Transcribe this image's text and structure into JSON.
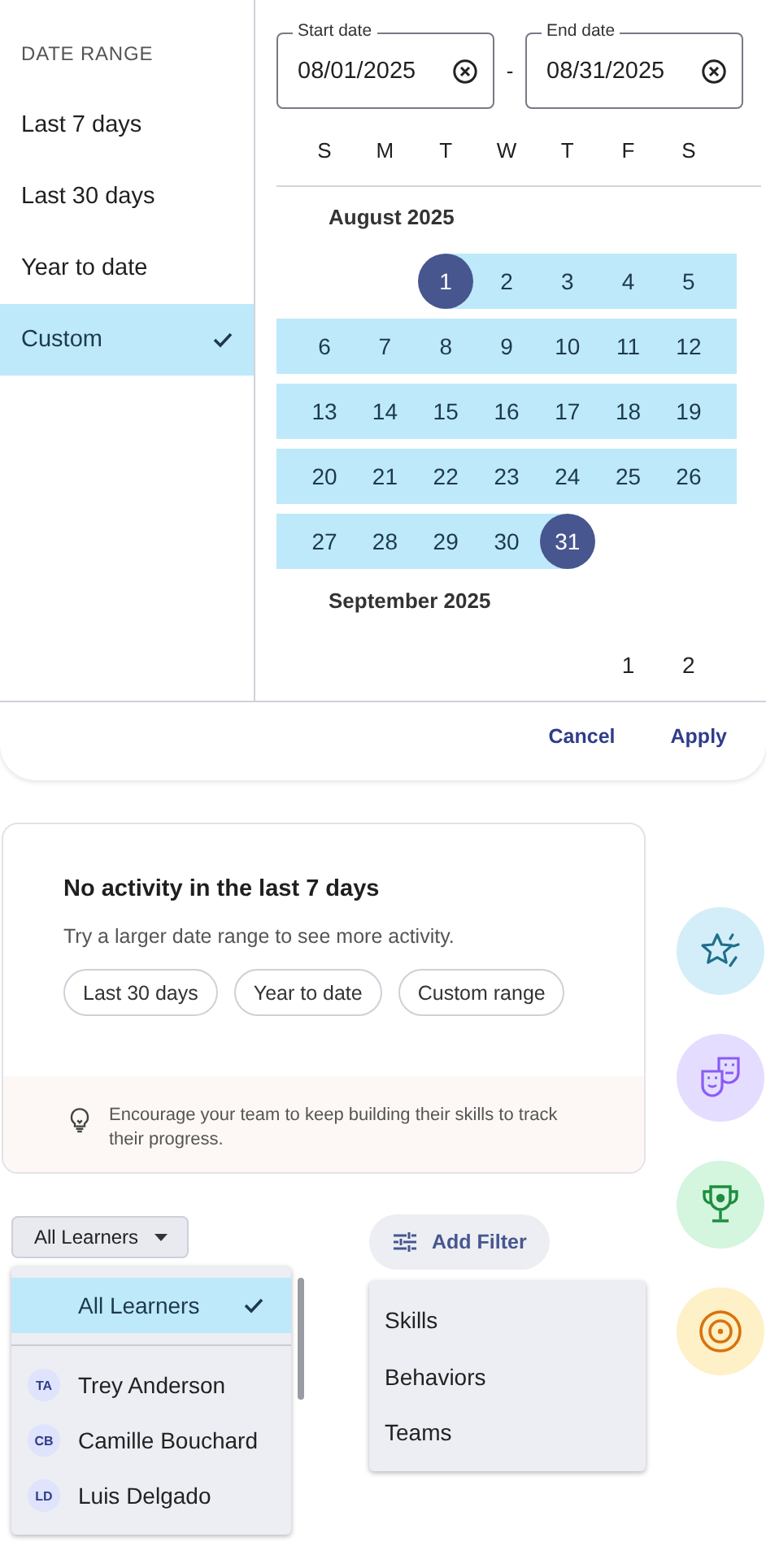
{
  "date_picker": {
    "heading": "DATE RANGE",
    "presets": [
      {
        "label": "Last 7 days",
        "selected": false
      },
      {
        "label": "Last 30 days",
        "selected": false
      },
      {
        "label": "Year to date",
        "selected": false
      },
      {
        "label": "Custom",
        "selected": true
      }
    ],
    "start_field": {
      "label": "Start date",
      "value": "08/01/2025"
    },
    "separator": "-",
    "end_field": {
      "label": "End date",
      "value": "08/31/2025"
    },
    "weekdays": [
      "S",
      "M",
      "T",
      "W",
      "T",
      "F",
      "S"
    ],
    "months": [
      {
        "title": "August 2025",
        "weeks": [
          {
            "right_aligned": true,
            "days": [
              {
                "day": "1",
                "selected": true,
                "in_range": true
              },
              {
                "day": "2",
                "selected": false,
                "in_range": true
              },
              {
                "day": "3",
                "selected": false,
                "in_range": true
              },
              {
                "day": "4",
                "selected": false,
                "in_range": true
              },
              {
                "day": "5",
                "selected": false,
                "in_range": true
              }
            ]
          },
          {
            "right_aligned": false,
            "days": [
              {
                "day": "6",
                "selected": false,
                "in_range": true
              },
              {
                "day": "7",
                "selected": false,
                "in_range": true
              },
              {
                "day": "8",
                "selected": false,
                "in_range": true
              },
              {
                "day": "9",
                "selected": false,
                "in_range": true
              },
              {
                "day": "10",
                "selected": false,
                "in_range": true
              },
              {
                "day": "11",
                "selected": false,
                "in_range": true
              },
              {
                "day": "12",
                "selected": false,
                "in_range": true
              }
            ]
          },
          {
            "right_aligned": false,
            "days": [
              {
                "day": "13",
                "selected": false,
                "in_range": true
              },
              {
                "day": "14",
                "selected": false,
                "in_range": true
              },
              {
                "day": "15",
                "selected": false,
                "in_range": true
              },
              {
                "day": "16",
                "selected": false,
                "in_range": true
              },
              {
                "day": "17",
                "selected": false,
                "in_range": true
              },
              {
                "day": "18",
                "selected": false,
                "in_range": true
              },
              {
                "day": "19",
                "selected": false,
                "in_range": true
              }
            ]
          },
          {
            "right_aligned": false,
            "days": [
              {
                "day": "20",
                "selected": false,
                "in_range": true
              },
              {
                "day": "21",
                "selected": false,
                "in_range": true
              },
              {
                "day": "22",
                "selected": false,
                "in_range": true
              },
              {
                "day": "23",
                "selected": false,
                "in_range": true
              },
              {
                "day": "24",
                "selected": false,
                "in_range": true
              },
              {
                "day": "25",
                "selected": false,
                "in_range": true
              },
              {
                "day": "26",
                "selected": false,
                "in_range": true
              }
            ]
          },
          {
            "right_aligned": false,
            "days": [
              {
                "day": "27",
                "selected": false,
                "in_range": true
              },
              {
                "day": "28",
                "selected": false,
                "in_range": true
              },
              {
                "day": "29",
                "selected": false,
                "in_range": true
              },
              {
                "day": "30",
                "selected": false,
                "in_range": true
              },
              {
                "day": "31",
                "selected": true,
                "in_range": true
              }
            ]
          }
        ]
      },
      {
        "title": "September 2025",
        "weeks": [
          {
            "right_aligned": true,
            "days": [
              {
                "day": "1",
                "selected": false,
                "in_range": false
              },
              {
                "day": "2",
                "selected": false,
                "in_range": false
              }
            ]
          }
        ]
      }
    ],
    "actions": [
      "Cancel",
      "Apply"
    ]
  },
  "empty_state": {
    "title": "No activity in the last 7 days",
    "message": "Try a larger date range to see more activity.",
    "chips": [
      "Last 30 days",
      "Year to date",
      "Custom range"
    ],
    "tip": "Encourage your team to keep building their skills to track their progress."
  },
  "learner_filter": {
    "button": "All Learners",
    "options": [
      {
        "label": "All Learners",
        "selected": true
      },
      {
        "initials": "TA",
        "label": "Trey Anderson",
        "selected": false
      },
      {
        "initials": "CB",
        "label": "Camille Bouchard",
        "selected": false
      },
      {
        "initials": "LD",
        "label": "Luis Delgado",
        "selected": false
      }
    ]
  },
  "add_filter": {
    "button": "Add Filter",
    "options": [
      "Skills",
      "Behaviors",
      "Teams"
    ]
  },
  "badges": [
    {
      "kind": "star",
      "color": "#d3eef8"
    },
    {
      "kind": "masks",
      "color": "#e4ddff"
    },
    {
      "kind": "trophy",
      "color": "#d4f5de"
    },
    {
      "kind": "target",
      "color": "#fef0c7"
    }
  ]
}
